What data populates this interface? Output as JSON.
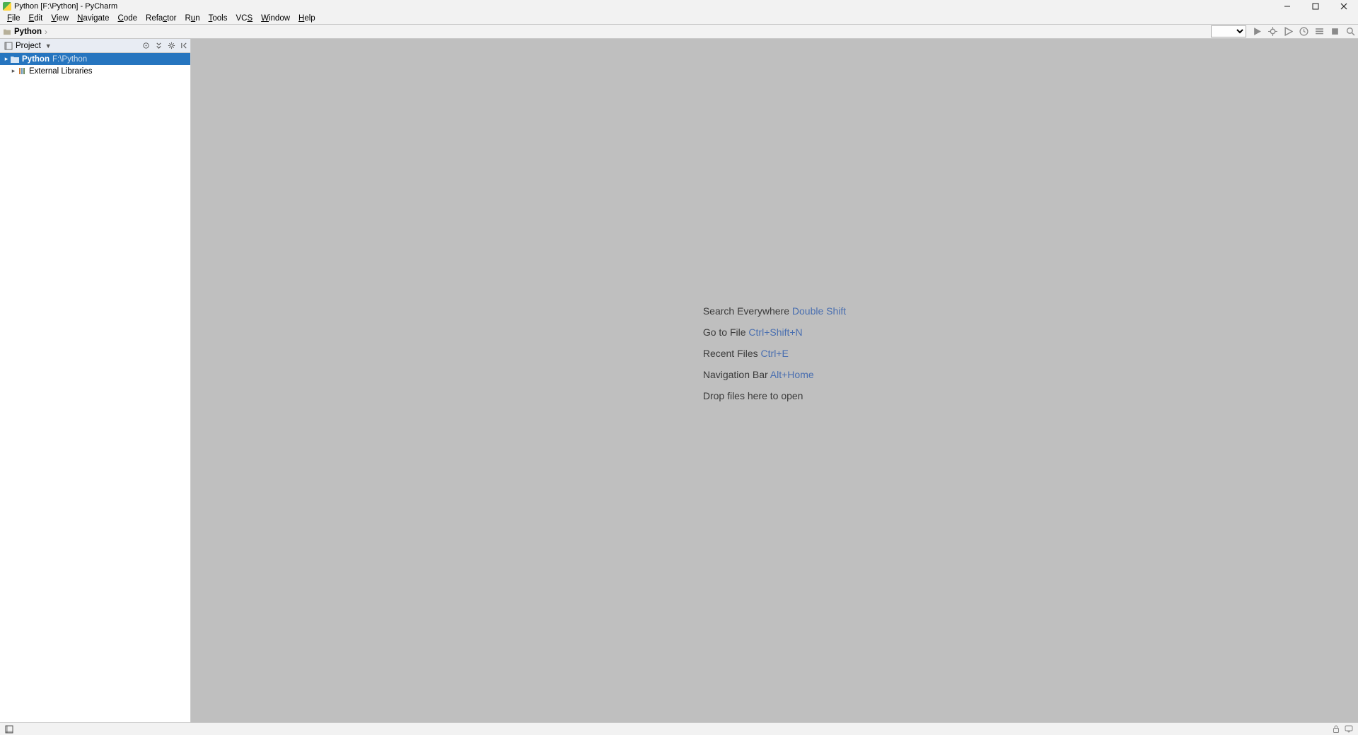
{
  "title": "Python [F:\\Python] - PyCharm",
  "menu": [
    "File",
    "Edit",
    "View",
    "Navigate",
    "Code",
    "Refactor",
    "Run",
    "Tools",
    "VCS",
    "Window",
    "Help"
  ],
  "menu_underline_idx": [
    0,
    0,
    0,
    0,
    0,
    4,
    1,
    0,
    2,
    0,
    0
  ],
  "breadcrumb": {
    "name": "Python"
  },
  "project_pane": {
    "title": "Project",
    "items": [
      {
        "type": "root",
        "name": "Python",
        "path": "F:\\Python",
        "selected": true
      },
      {
        "type": "lib",
        "name": "External Libraries",
        "selected": false
      }
    ]
  },
  "welcome": {
    "lines": [
      {
        "label": "Search Everywhere",
        "shortcut": "Double Shift"
      },
      {
        "label": "Go to File",
        "shortcut": "Ctrl+Shift+N"
      },
      {
        "label": "Recent Files",
        "shortcut": "Ctrl+E"
      },
      {
        "label": "Navigation Bar",
        "shortcut": "Alt+Home"
      },
      {
        "label": "Drop files here to open",
        "shortcut": ""
      }
    ]
  },
  "toolbar_right": {
    "config_placeholder": ""
  }
}
